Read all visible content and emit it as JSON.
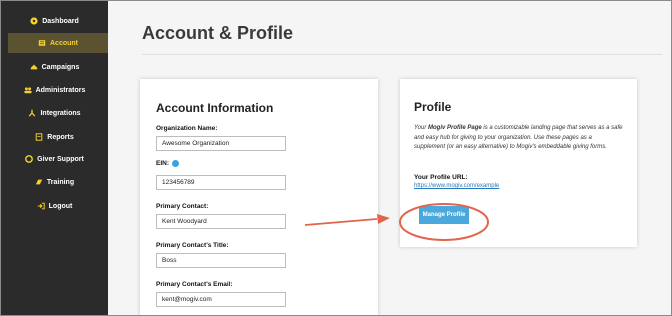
{
  "sidebar": {
    "items": [
      {
        "label": "Dashboard",
        "icon": "dashboard-icon"
      },
      {
        "label": "Account",
        "icon": "account-icon",
        "active": true
      },
      {
        "label": "Campaigns",
        "icon": "campaigns-icon"
      },
      {
        "label": "Administrators",
        "icon": "administrators-icon"
      },
      {
        "label": "Integrations",
        "icon": "integrations-icon"
      },
      {
        "label": "Reports",
        "icon": "reports-icon"
      },
      {
        "label": "Giver Support",
        "icon": "giver-support-icon"
      },
      {
        "label": "Training",
        "icon": "training-icon"
      },
      {
        "label": "Logout",
        "icon": "logout-icon"
      }
    ],
    "accent_color": "#f5d12a"
  },
  "page": {
    "title": "Account & Profile"
  },
  "account": {
    "title": "Account Information",
    "org_name_label": "Organization Name:",
    "org_name_value": "Awesome Organization",
    "ein_label": "EIN:",
    "ein_value": "123456789",
    "primary_contact_label": "Primary Contact:",
    "primary_contact_value": "Kent Woodyard",
    "contact_title_label": "Primary Contact's Title:",
    "contact_title_value": "Boss",
    "contact_email_label": "Primary Contact's Email:",
    "contact_email_value": "kent@mogiv.com"
  },
  "profile": {
    "title": "Profile",
    "desc_prefix": "Your ",
    "desc_bold": "Mogiv Profile Page",
    "desc_middle": " is a customizable landing page that serves as a safe and easy hub for giving to your organization. Use these pages as a supplement (or an easy alternative) to Mogiv's embeddable giving forms.",
    "url_label": "Your Profile URL:",
    "url_value": "https://www.mogiv.com/example",
    "button_label": "Manage Profile",
    "button_color": "#4aa8dc"
  },
  "annotation_color": "#e2644a"
}
